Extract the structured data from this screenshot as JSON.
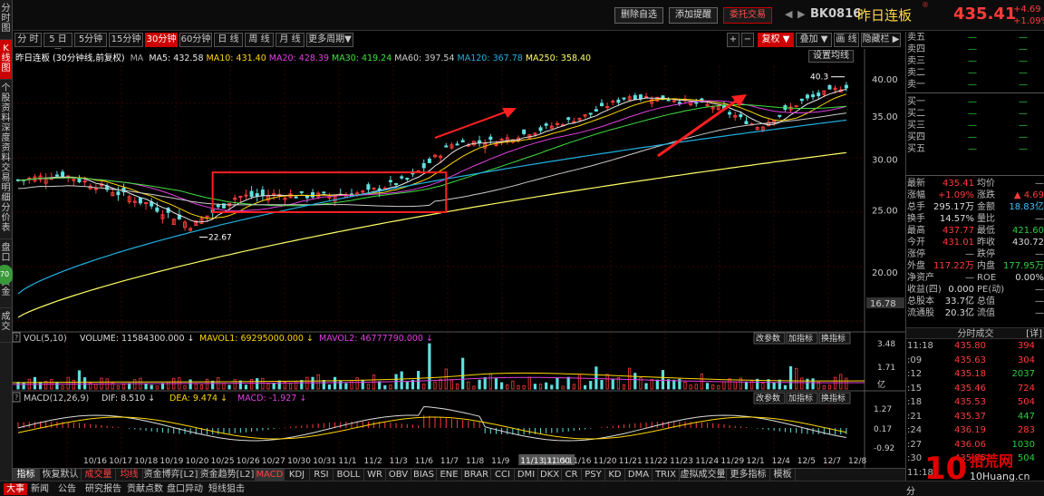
{
  "left_rail": [
    "分时图",
    "K线图",
    "个股资料",
    "深度资料",
    "交易明细",
    "分价表",
    "盘口",
    "资金",
    "成交"
  ],
  "left_rail_bubble": "70",
  "topbar": {
    "buttons": [
      "删除自选",
      "添加提醒",
      "委托交易"
    ],
    "code": "BK0816",
    "name": "昨日连板",
    "price": "435.41",
    "change": "+4.69",
    "change_pct": "+1.09%"
  },
  "periods": [
    "分 时",
    "5 日 ▼",
    "5分钟",
    "15分钟",
    "30分钟",
    "60分钟",
    "日 线",
    "周 线",
    "月 线",
    "更多周期▼"
  ],
  "active_period": "30分钟",
  "chart_tools": [
    "+",
    "−",
    "复权 ▼",
    "叠加 ▼",
    "画 线",
    "隐藏栏 ▶"
  ],
  "settings_btn": "设置均线",
  "ma_legend": {
    "title": "昨日连板 (30分钟线,前复权)",
    "flag": "MA",
    "items": [
      {
        "label": "MA5: 432.58",
        "color": "#e8e8e8"
      },
      {
        "label": "MA10: 431.40",
        "color": "#ffd700"
      },
      {
        "label": "MA20: 428.39",
        "color": "#e040e0"
      },
      {
        "label": "MA30: 419.24",
        "color": "#40e040"
      },
      {
        "label": "MA60: 397.54",
        "color": "#cccccc"
      },
      {
        "label": "MA120: 367.78",
        "color": "#20b0e0"
      },
      {
        "label": "MA250: 358.40",
        "color": "#ffff66"
      }
    ]
  },
  "price_axis": [
    "40.00",
    "35.00",
    "30.00",
    "25.00",
    "20.00",
    "16.78"
  ],
  "price_labels": {
    "high": "40.3",
    "low": "22.67"
  },
  "vol_legend": {
    "name": "VOL(5,10)",
    "items": [
      {
        "label": "VOLUME: 11584300.000",
        "color": "#dddddd"
      },
      {
        "label": "MAVOL1: 69295000.000",
        "color": "#ffd700"
      },
      {
        "label": "MAVOL2: 46777790.000",
        "color": "#e040e0"
      }
    ]
  },
  "vol_axis": [
    "3.48",
    "1.71",
    "亿"
  ],
  "macd_legend": {
    "name": "MACD(12,26,9)",
    "items": [
      {
        "label": "DIF: 8.510",
        "color": "#dddddd"
      },
      {
        "label": "DEA: 9.474",
        "color": "#ffd700"
      },
      {
        "label": "MACD: -1.927",
        "color": "#e040e0"
      }
    ]
  },
  "macd_axis": [
    "1.27",
    "0.17",
    "-0.92"
  ],
  "indicator_buttons": [
    "改参数",
    "加指标",
    "换指标"
  ],
  "x_axis": [
    "10/16",
    "10/17",
    "10/18",
    "10/19",
    "10/20",
    "10/25",
    "10/26",
    "10/27",
    "10/30",
    "10/31",
    "11/1",
    "11/2",
    "11/3",
    "11/6",
    "11/7",
    "11/8",
    "11/9",
    "11/13,11:00",
    "11/15",
    "11/16",
    "11/20",
    "11/21",
    "11/22",
    "11/23",
    "11/24",
    "11/29",
    "12/1",
    "12/4",
    "12/5",
    "12/7",
    "12/8"
  ],
  "chart_data": {
    "type": "candlestick",
    "period": "30分钟",
    "x": [
      "10/16",
      "10/17",
      "10/18",
      "10/19",
      "10/20",
      "10/25",
      "10/30",
      "11/2",
      "11/6",
      "11/8",
      "11/13",
      "11/16",
      "11/21",
      "11/24",
      "11/29",
      "12/1",
      "12/4",
      "12/5",
      "12/7",
      "12/8"
    ],
    "close": [
      27.8,
      28.4,
      27.0,
      25.5,
      23.6,
      26.2,
      26.4,
      26.3,
      26.6,
      28.0,
      31.8,
      32.0,
      33.4,
      35.0,
      37.6,
      37.2,
      36.2,
      33.6,
      37.0,
      39.0
    ],
    "ylim": [
      16.78,
      40.3
    ],
    "annotations": [
      "40.3",
      "22.67"
    ]
  },
  "quote": {
    "book": [
      {
        "label": "卖五",
        "val": "—"
      },
      {
        "label": "卖四",
        "val": "—"
      },
      {
        "label": "卖三",
        "val": "—"
      },
      {
        "label": "卖二",
        "val": "—"
      },
      {
        "label": "卖一",
        "val": "—"
      },
      {
        "label": "买一",
        "val": "—"
      },
      {
        "label": "买二",
        "val": "—"
      },
      {
        "label": "买三",
        "val": "—"
      },
      {
        "label": "买四",
        "val": "—"
      },
      {
        "label": "买五",
        "val": "—"
      }
    ],
    "stats": [
      {
        "l1": "最新",
        "v1": "435.41",
        "c1": "#ff3b3b",
        "l2": "均价",
        "v2": "—",
        "c2": "#bbb"
      },
      {
        "l1": "涨幅",
        "v1": "+1.09%",
        "c1": "#ff3b3b",
        "l2": "涨跌",
        "v2": "▲ 4.69",
        "c2": "#ff3b3b"
      },
      {
        "l1": "总手",
        "v1": "295.17万",
        "c1": "#ddd",
        "l2": "金额",
        "v2": "18.83亿",
        "c2": "#40c0ff"
      },
      {
        "l1": "换手",
        "v1": "14.57%",
        "c1": "#ddd",
        "l2": "量比",
        "v2": "—",
        "c2": "#bbb"
      },
      {
        "l1": "最高",
        "v1": "437.77",
        "c1": "#ff3b3b",
        "l2": "最低",
        "v2": "421.60",
        "c2": "#2ecc40"
      },
      {
        "l1": "今开",
        "v1": "431.01",
        "c1": "#ff3b3b",
        "l2": "昨收",
        "v2": "430.72",
        "c2": "#ddd"
      },
      {
        "l1": "涨停",
        "v1": "—",
        "c1": "#bbb",
        "l2": "跌停",
        "v2": "—",
        "c2": "#bbb"
      },
      {
        "l1": "外盘",
        "v1": "117.22万",
        "c1": "#ff3b3b",
        "l2": "内盘",
        "v2": "177.95万",
        "c2": "#2ecc40"
      },
      {
        "l1": "净资产",
        "v1": "—",
        "c1": "#bbb",
        "l2": "ROE",
        "v2": "0.00%",
        "c2": "#ddd"
      },
      {
        "l1": "收益(四)",
        "v1": "0.000",
        "c1": "#ddd",
        "l2": "PE(动)",
        "v2": "—",
        "c2": "#bbb"
      },
      {
        "l1": "总股本",
        "v1": "33.7亿",
        "c1": "#ddd",
        "l2": "总值",
        "v2": "—",
        "c2": "#bbb"
      },
      {
        "l1": "流通股",
        "v1": "20.3亿",
        "c1": "#ddd",
        "l2": "流值",
        "v2": "—",
        "c2": "#bbb"
      }
    ],
    "ticks_header": "分时成交",
    "ticks_more": "[详]",
    "ticks": [
      {
        "t": "11:18",
        "p": "435.80",
        "v": "394",
        "vc": "#ff3b3b"
      },
      {
        "t": ":09",
        "p": "435.63",
        "v": "304",
        "vc": "#ff3b3b"
      },
      {
        "t": ":12",
        "p": "435.18",
        "v": "2037",
        "vc": "#2ecc40"
      },
      {
        "t": ":15",
        "p": "435.46",
        "v": "724",
        "vc": "#ff3b3b"
      },
      {
        "t": ":18",
        "p": "435.53",
        "v": "504",
        "vc": "#ff3b3b"
      },
      {
        "t": ":21",
        "p": "435.37",
        "v": "447",
        "vc": "#2ecc40"
      },
      {
        "t": ":24",
        "p": "436.19",
        "v": "283",
        "vc": "#ff3b3b"
      },
      {
        "t": ":27",
        "p": "436.06",
        "v": "1030",
        "vc": "#2ecc40"
      },
      {
        "t": ":30",
        "p": "435.85",
        "v": "504",
        "vc": "#2ecc40"
      },
      {
        "t": "11:18",
        "p": "",
        "v": "",
        "vc": "#ddd"
      }
    ]
  },
  "bottom_tabs": [
    "指标",
    "恢复默认",
    "成交量",
    "均线",
    "资金博弈[L2]",
    "资金趋势[L2]",
    "MACD",
    "KDJ",
    "RSI",
    "BOLL",
    "WR",
    "OBV",
    "BIAS",
    "ENE",
    "BRAR",
    "CCI",
    "DMI",
    "DKX",
    "CR",
    "PSY",
    "KD",
    "DMA",
    "TRIX",
    "虚拟成交量",
    "更多指标",
    "模板"
  ],
  "news_tabs": [
    "大事",
    "新闻",
    "公告",
    "研究报告",
    "贡献点数",
    "盘口异动",
    "短线狙击"
  ],
  "footer_right": "分",
  "watermark": {
    "big": "10",
    "site": "拾荒网",
    "url": "10Huang.cn"
  },
  "colors": {
    "up": "#ff3b3b",
    "down": "#2ecc40",
    "accent": "#c00000",
    "name": "#ffd84a"
  }
}
